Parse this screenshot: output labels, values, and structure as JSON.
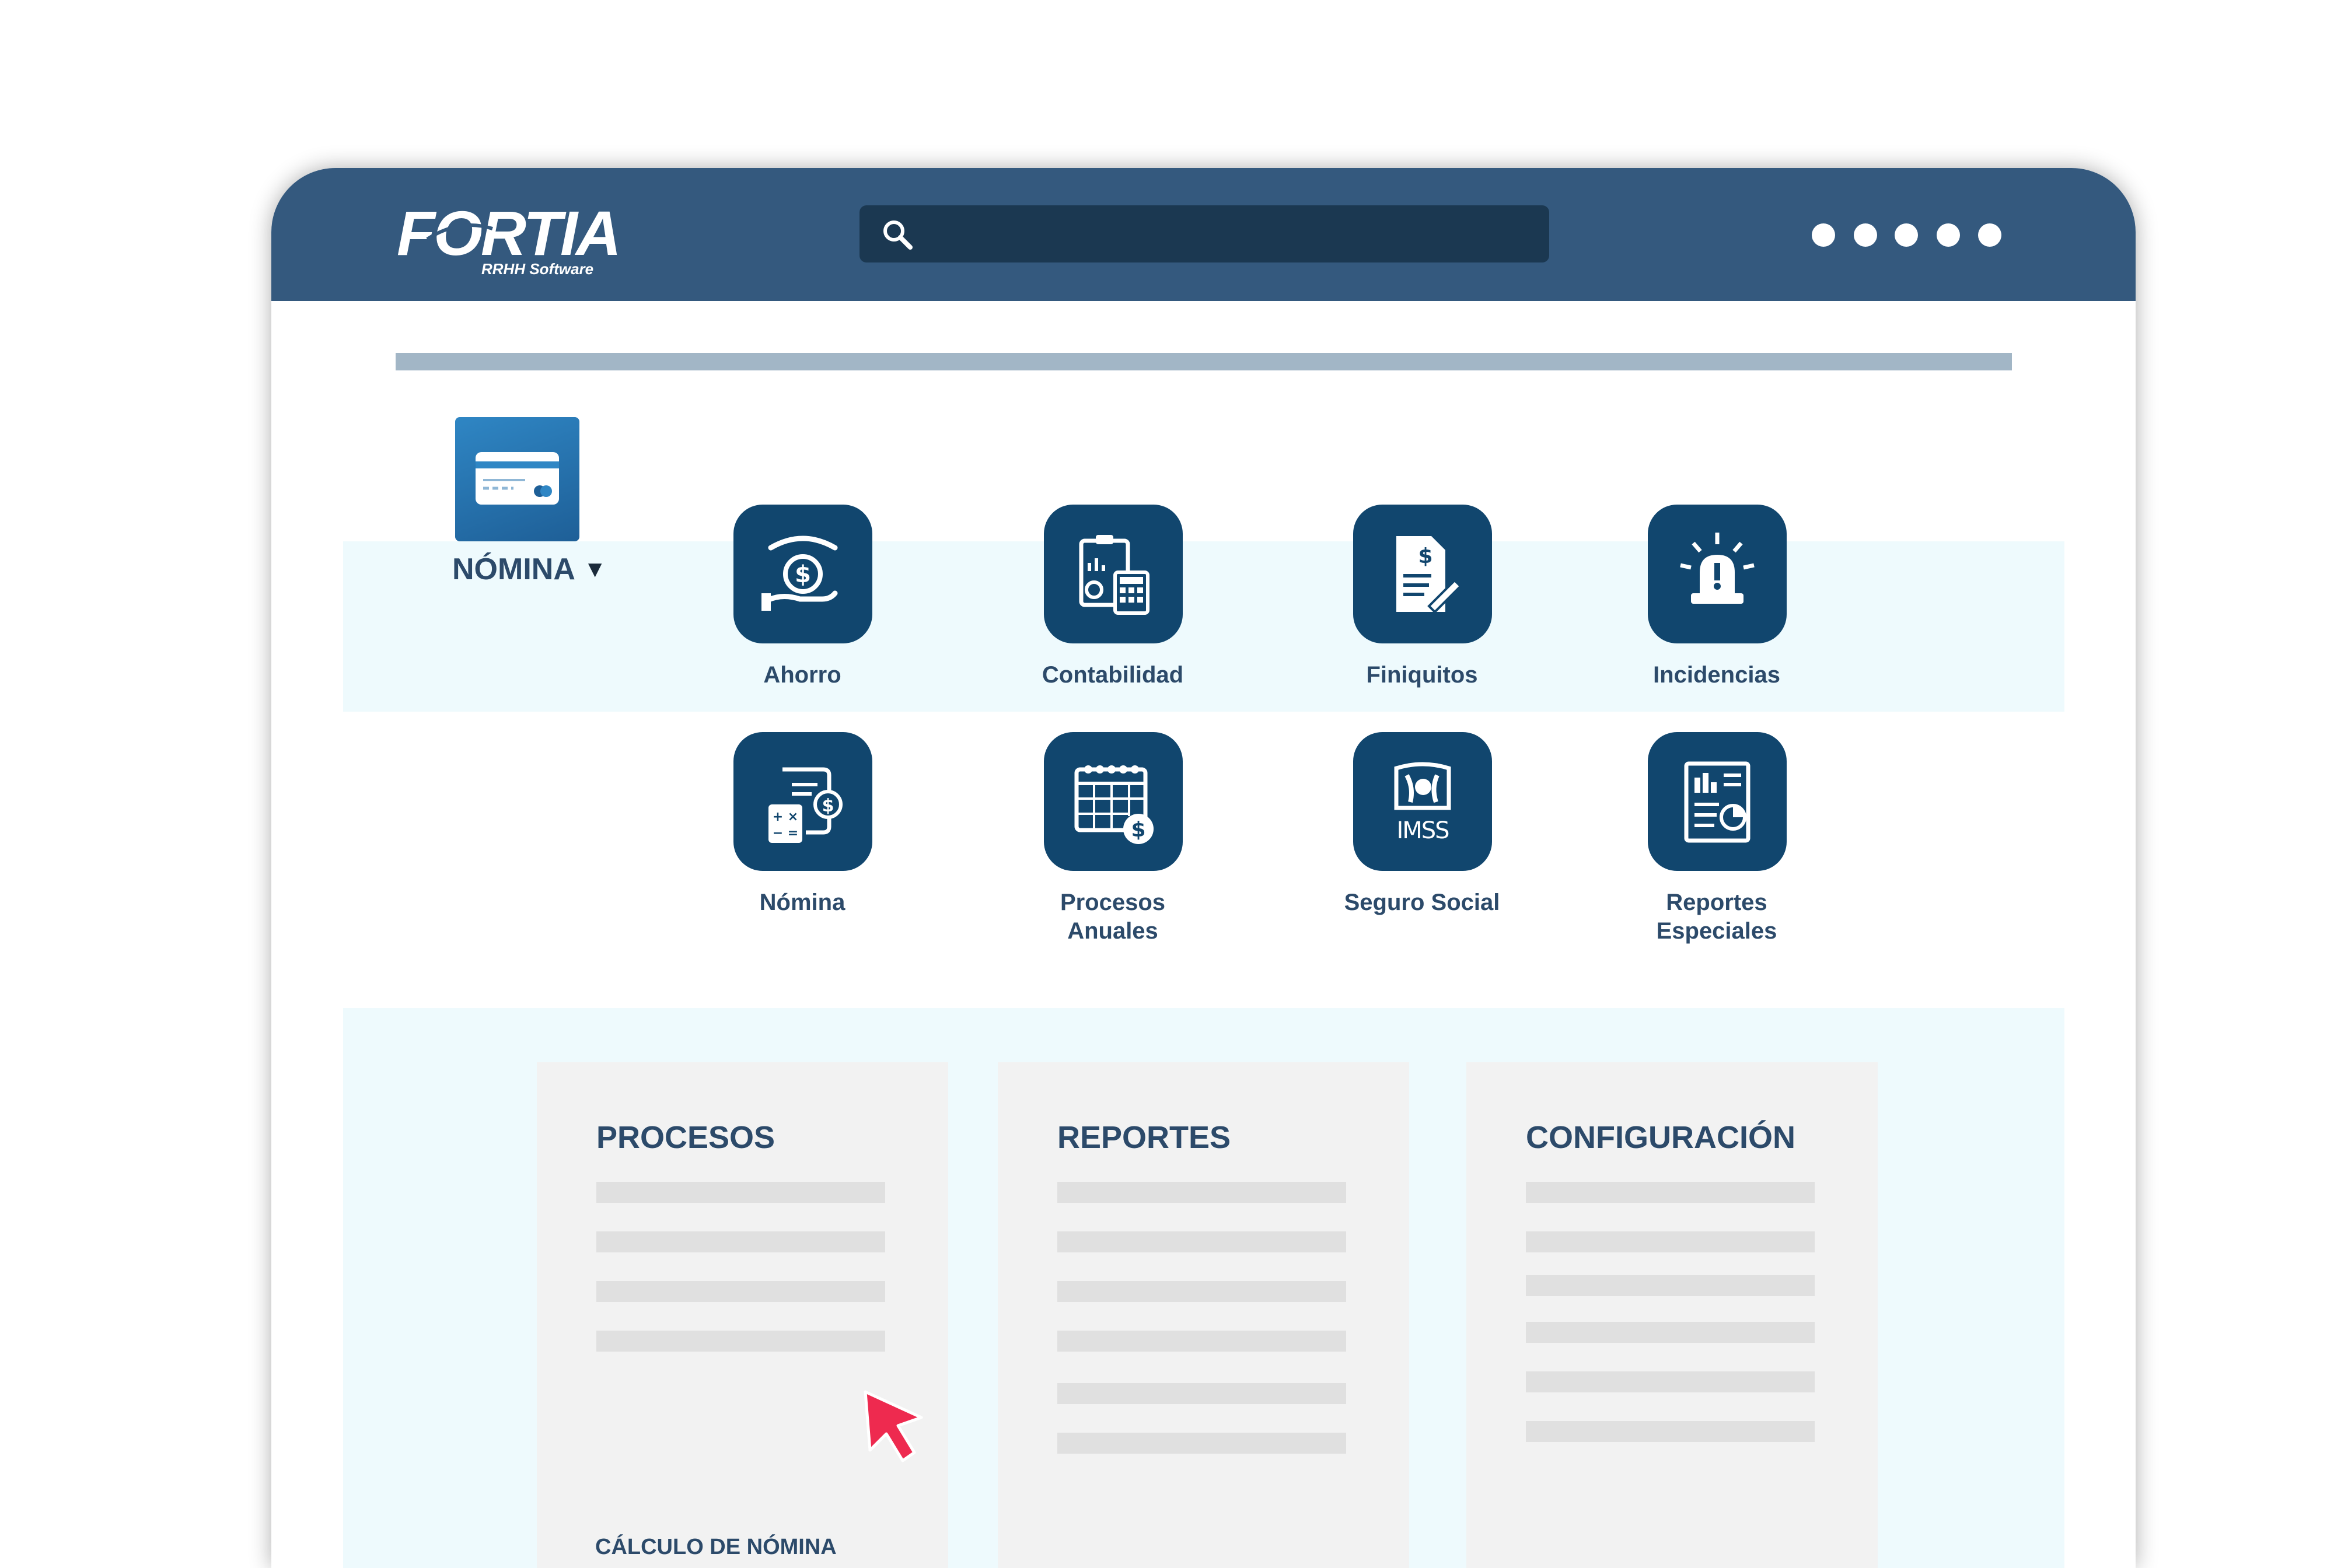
{
  "header": {
    "logo": {
      "wordmark": "FORTIA",
      "tagline": "RRHH Software"
    },
    "search": {
      "value": "",
      "placeholder": ""
    }
  },
  "section": {
    "label": "NÓMINA",
    "caret": "▼"
  },
  "modules": [
    {
      "label": "Ahorro",
      "icon": "hand-money-icon"
    },
    {
      "label": "Contabilidad",
      "icon": "calculator-clipboard-icon"
    },
    {
      "label": "Finiquitos",
      "icon": "document-signature-icon"
    },
    {
      "label": "Incidencias",
      "icon": "alarm-beacon-icon"
    },
    {
      "label": "Nómina",
      "icon": "payroll-calculator-icon"
    },
    {
      "label": "Procesos\nAnuales",
      "icon": "calendar-money-icon"
    },
    {
      "label": "Seguro Social",
      "icon": "imss-logo-icon"
    },
    {
      "label": "Reportes\nEspeciales",
      "icon": "report-chart-icon"
    }
  ],
  "imss_text": "IMSS",
  "panels": [
    {
      "title": "PROCESOS",
      "link": "CÁLCULO DE NÓMINA"
    },
    {
      "title": "REPORTES"
    },
    {
      "title": "CONFIGURACIÓN"
    }
  ],
  "colors": {
    "topbar": "#34597e",
    "search_bg": "#1b3851",
    "tile": "#11466e",
    "text": "#2c4a6a",
    "band": "#eefafd",
    "cursor": "#ee2a4f"
  }
}
